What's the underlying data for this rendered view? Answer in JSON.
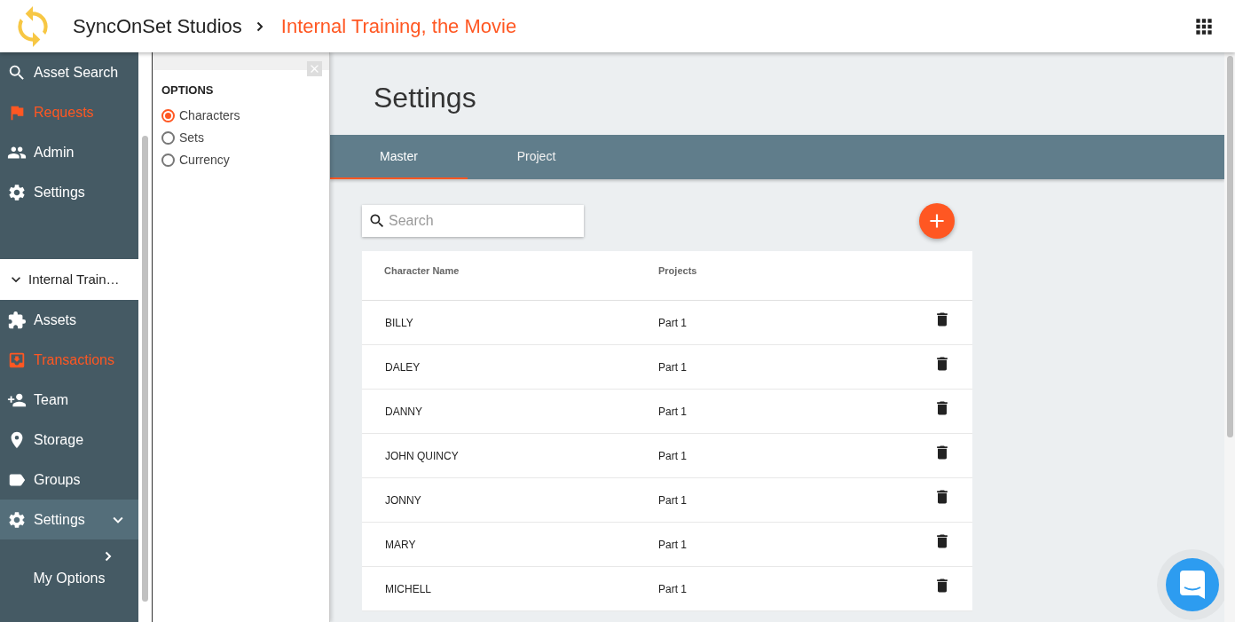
{
  "header": {
    "company": "SyncOnSet Studios",
    "project": "Internal Training, the Movie"
  },
  "sidebar": {
    "top_items": [
      {
        "label": "Asset Search",
        "accent": false
      },
      {
        "label": "Requests",
        "accent": true
      },
      {
        "label": "Admin",
        "accent": false
      },
      {
        "label": "Settings",
        "accent": false
      }
    ],
    "project": {
      "label": "Internal Train…",
      "expanded": true
    },
    "project_items": [
      {
        "label": "Assets",
        "accent": false,
        "kind": "link"
      },
      {
        "label": "Transactions",
        "accent": true,
        "kind": "link"
      },
      {
        "label": "Team",
        "accent": false,
        "kind": "link"
      },
      {
        "label": "Storage",
        "accent": false,
        "kind": "link"
      },
      {
        "label": "Groups",
        "accent": false,
        "kind": "link"
      },
      {
        "label": "Settings",
        "accent": false,
        "kind": "group",
        "expanded": true,
        "children": [
          {
            "label": "My Options"
          }
        ]
      }
    ]
  },
  "options": {
    "title": "OPTIONS",
    "choices": [
      {
        "label": "Characters",
        "selected": true
      },
      {
        "label": "Sets",
        "selected": false
      },
      {
        "label": "Currency",
        "selected": false
      }
    ]
  },
  "page": {
    "title": "Settings",
    "tabs": [
      {
        "label": "Master",
        "selected": true
      },
      {
        "label": "Project",
        "selected": false
      }
    ],
    "search": {
      "placeholder": "Search"
    },
    "table": {
      "columns": [
        "Character Name",
        "Projects"
      ],
      "rows": [
        {
          "name": "BILLY",
          "projects": "Part 1"
        },
        {
          "name": "DALEY",
          "projects": "Part 1"
        },
        {
          "name": "DANNY",
          "projects": "Part 1"
        },
        {
          "name": "JOHN QUINCY",
          "projects": "Part 1"
        },
        {
          "name": "JONNY",
          "projects": "Part 1"
        },
        {
          "name": "MARY",
          "projects": "Part 1"
        },
        {
          "name": "MICHELL",
          "projects": "Part 1"
        }
      ]
    }
  }
}
